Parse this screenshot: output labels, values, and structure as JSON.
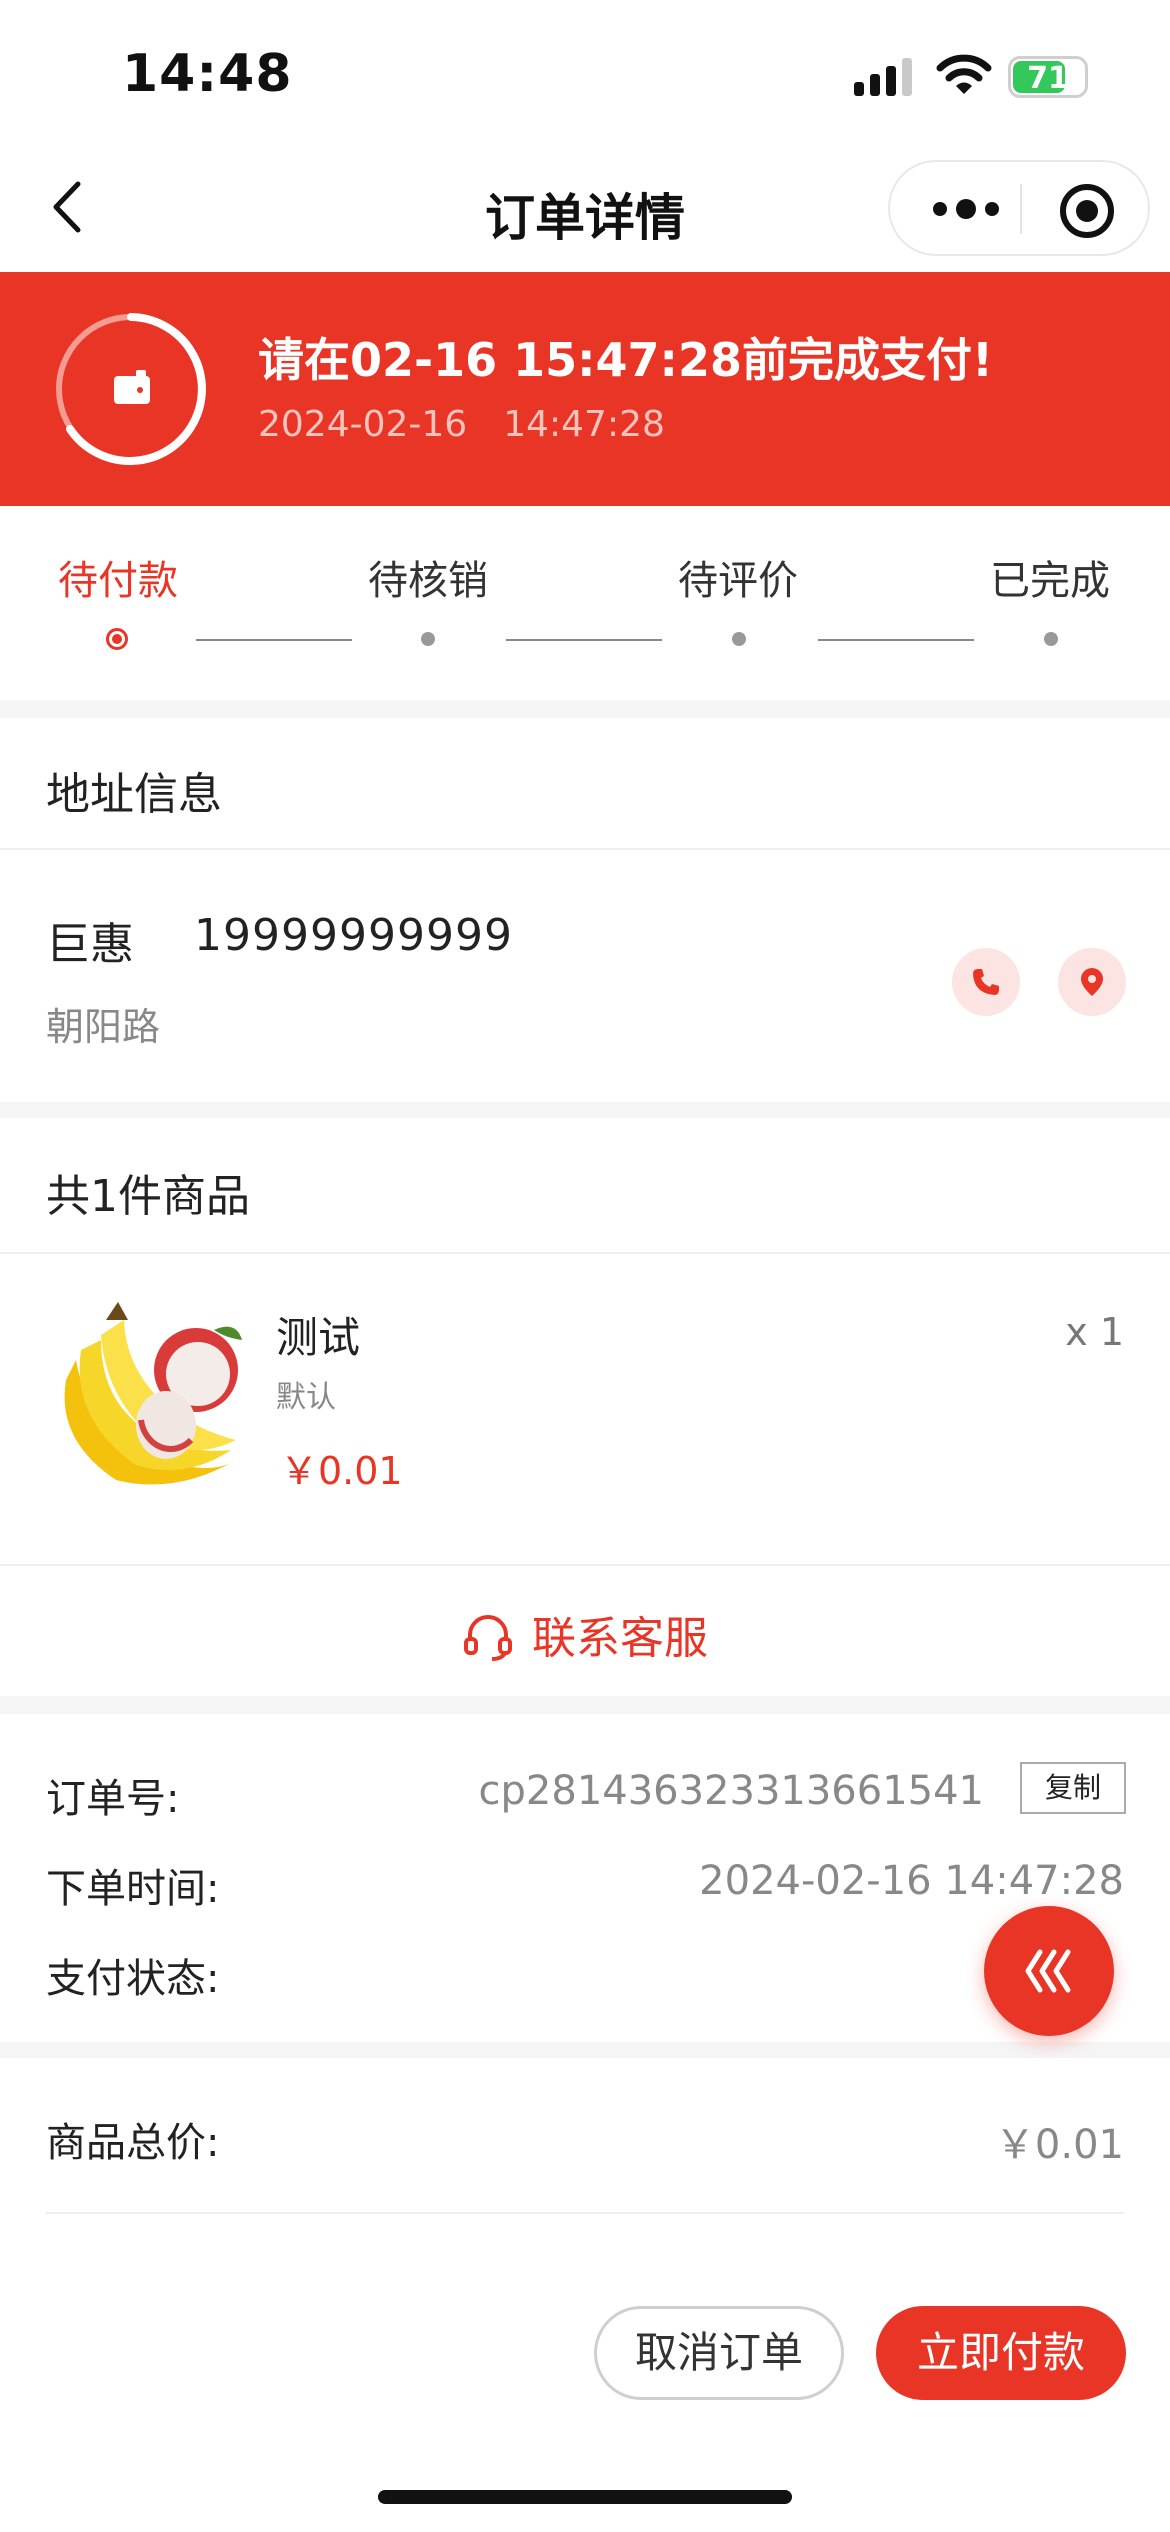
{
  "status_bar": {
    "time": "14:48",
    "battery": "71"
  },
  "nav": {
    "title": "订单详情"
  },
  "banner": {
    "message": "请在02-16 15:47:28前完成支付!",
    "date": "2024-02-16",
    "time": "14:47:28"
  },
  "steps": [
    {
      "label": "待付款",
      "active": true
    },
    {
      "label": "待核销",
      "active": false
    },
    {
      "label": "待评价",
      "active": false
    },
    {
      "label": "已完成",
      "active": false
    }
  ],
  "address": {
    "section_title": "地址信息",
    "name": "巨惠",
    "phone": "19999999999",
    "road": "朝阳路"
  },
  "goods": {
    "section_title": "共1件商品",
    "items": [
      {
        "name": "测试",
        "spec": "默认",
        "price": "￥0.01",
        "qty": "x 1"
      }
    ],
    "service_label": "联系客服"
  },
  "order_info": {
    "order_no_label": "订单号:",
    "order_no": "cp281436323313661541",
    "copy_label": "复制",
    "time_label": "下单时间:",
    "time": "2024-02-16 14:47:28",
    "pay_status_label": "支付状态:"
  },
  "totals": {
    "goods_total_label": "商品总价:",
    "goods_total": "￥0.01"
  },
  "actions": {
    "cancel_label": "取消订单",
    "pay_label": "立即付款"
  },
  "colors": {
    "accent": "#e83526",
    "accent_light": "#fbe4e2"
  }
}
